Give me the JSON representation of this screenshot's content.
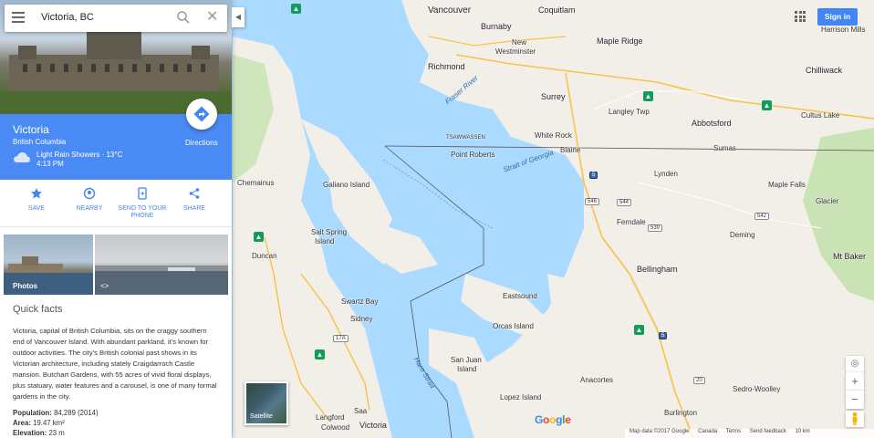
{
  "search": {
    "query": "Victoria, BC"
  },
  "place": {
    "name": "Victoria",
    "region": "British Columbia",
    "weather": "Light Rain Showers · 13°C",
    "time": "4:13 PM",
    "directions_label": "Directions"
  },
  "actions": [
    {
      "label": "SAVE",
      "icon": "star-icon"
    },
    {
      "label": "NEARBY",
      "icon": "nearby-icon"
    },
    {
      "label": "SEND TO YOUR PHONE",
      "line1": "SEND TO YOUR",
      "line2": "PHONE",
      "icon": "send-to-phone-icon"
    },
    {
      "label": "SHARE",
      "icon": "share-icon"
    }
  ],
  "photos": {
    "photos_label": "Photos"
  },
  "facts": {
    "heading": "Quick facts",
    "description": "Victoria, capital of British Columbia, sits on the craggy southern end of Vancouver Island. With abundant parkland, it's known for outdoor activities. The city's British colonial past shows in its Victorian architecture, including stately Craigdarroch Castle mansion. Butchart Gardens, with 55 acres of vivid floral displays, plus statuary, water features and a carousel, is one of many formal gardens in the city.",
    "population_label": "Population:",
    "population_value": "84,289 (2014)",
    "area_label": "Area:",
    "area_value": "19.47 km²",
    "elevation_label": "Elevation:",
    "elevation_value": "23 m"
  },
  "map": {
    "places": [
      {
        "id": "vancouver",
        "text": "Vancouver"
      },
      {
        "id": "coquitlam",
        "text": "Coquitlam"
      },
      {
        "id": "burnaby",
        "text": "Burnaby"
      },
      {
        "id": "new-westminster-1",
        "text": "New"
      },
      {
        "id": "new-westminster-2",
        "text": "Westminster"
      },
      {
        "id": "maple-ridge",
        "text": "Maple Ridge"
      },
      {
        "id": "richmond",
        "text": "Richmond"
      },
      {
        "id": "surrey",
        "text": "Surrey"
      },
      {
        "id": "langley",
        "text": "Langley Twp"
      },
      {
        "id": "abbotsford",
        "text": "Abbotsford"
      },
      {
        "id": "chilliwack",
        "text": "Chilliwack"
      },
      {
        "id": "harrison",
        "text": "Harrison Mills"
      },
      {
        "id": "cultus",
        "text": "Cultus Lake"
      },
      {
        "id": "tsawwassen",
        "text": "TSAWWASSEN"
      },
      {
        "id": "white-rock",
        "text": "White Rock"
      },
      {
        "id": "point-roberts",
        "text": "Point Roberts"
      },
      {
        "id": "blaine",
        "text": "Blaine"
      },
      {
        "id": "sumas",
        "text": "Sumas"
      },
      {
        "id": "lynden",
        "text": "Lynden"
      },
      {
        "id": "maple-falls",
        "text": "Maple Falls"
      },
      {
        "id": "glacier",
        "text": "Glacier"
      },
      {
        "id": "chemainus",
        "text": "Chemainus"
      },
      {
        "id": "galiano",
        "text": "Galiano Island"
      },
      {
        "id": "salt-spring-1",
        "text": "Salt Spring"
      },
      {
        "id": "salt-spring-2",
        "text": "Island"
      },
      {
        "id": "ferndale",
        "text": "Ferndale"
      },
      {
        "id": "deming",
        "text": "Deming"
      },
      {
        "id": "mt-baker",
        "text": "Mt Baker"
      },
      {
        "id": "duncan",
        "text": "Duncan"
      },
      {
        "id": "bellingham",
        "text": "Bellingham"
      },
      {
        "id": "eastsound",
        "text": "Eastsound"
      },
      {
        "id": "swartz-bay",
        "text": "Swartz Bay"
      },
      {
        "id": "sidney",
        "text": "Sidney"
      },
      {
        "id": "orcas",
        "text": "Orcas Island"
      },
      {
        "id": "san-juan-1",
        "text": "San Juan"
      },
      {
        "id": "san-juan-2",
        "text": "Island"
      },
      {
        "id": "lopez",
        "text": "Lopez Island"
      },
      {
        "id": "anacortes",
        "text": "Anacortes"
      },
      {
        "id": "sedro",
        "text": "Sedro-Woolley"
      },
      {
        "id": "burlington",
        "text": "Burlington"
      },
      {
        "id": "langford",
        "text": "Langford"
      },
      {
        "id": "colwood",
        "text": "Colwood"
      },
      {
        "id": "saanich",
        "text": "Saa"
      },
      {
        "id": "victoria",
        "text": "Victoria"
      },
      {
        "id": "strait-georgia",
        "text": "Strait of Georgia"
      },
      {
        "id": "fraser",
        "text": "Fraser River"
      },
      {
        "id": "haro",
        "text": "Haro Strait"
      }
    ],
    "highways": [
      "17A",
      "5",
      "546",
      "539",
      "542",
      "20",
      "5",
      "544"
    ]
  },
  "controls": {
    "signin_label": "Sign in",
    "satellite_label": "Satellite",
    "zoom_in": "+",
    "zoom_out": "−",
    "google_logo": "Google"
  },
  "footer": {
    "items": [
      "Map data ©2017 Google",
      "Canada",
      "Terms",
      "Send feedback",
      "10 km"
    ]
  }
}
